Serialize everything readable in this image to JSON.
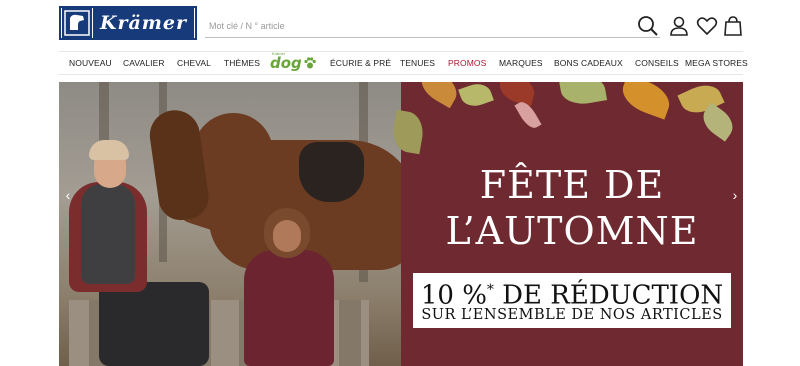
{
  "header": {
    "logo_text": "Krämer",
    "search_placeholder": "Mot clé / N ° article",
    "search_icon": "search-icon",
    "account_icon": "user-icon",
    "wishlist_icon": "heart-icon",
    "cart_icon": "shopping-bag-icon"
  },
  "nav": {
    "items": [
      {
        "label": "NOUVEAU"
      },
      {
        "label": "CAVALIER"
      },
      {
        "label": "CHEVAL"
      },
      {
        "label": "THÈMES"
      },
      {
        "label": "dog",
        "top_label": "Krämer"
      },
      {
        "label": "ÉCURIE & PRÉ"
      },
      {
        "label": "TENUES"
      },
      {
        "label": "PROMOS"
      },
      {
        "label": "MARQUES"
      },
      {
        "label": "BONS CADEAUX"
      },
      {
        "label": "CONSEILS"
      },
      {
        "label": "MEGA STORES"
      }
    ]
  },
  "banner": {
    "headline_line1": "FÊTE DE",
    "headline_line2": "L’AUTOMNE",
    "offer_percent": "10 %",
    "offer_asterisk": "*",
    "offer_rest": " DE RÉDUCTION",
    "offer_sub": "SUR L’ENSEMBLE DE NOS ARTICLES",
    "prev_arrow": "‹",
    "next_arrow": "›",
    "panel_color": "#6e2a30"
  },
  "colors": {
    "brand_blue": "#163a7a",
    "promo_red": "#b3142f",
    "dog_green": "#6aa53a"
  }
}
